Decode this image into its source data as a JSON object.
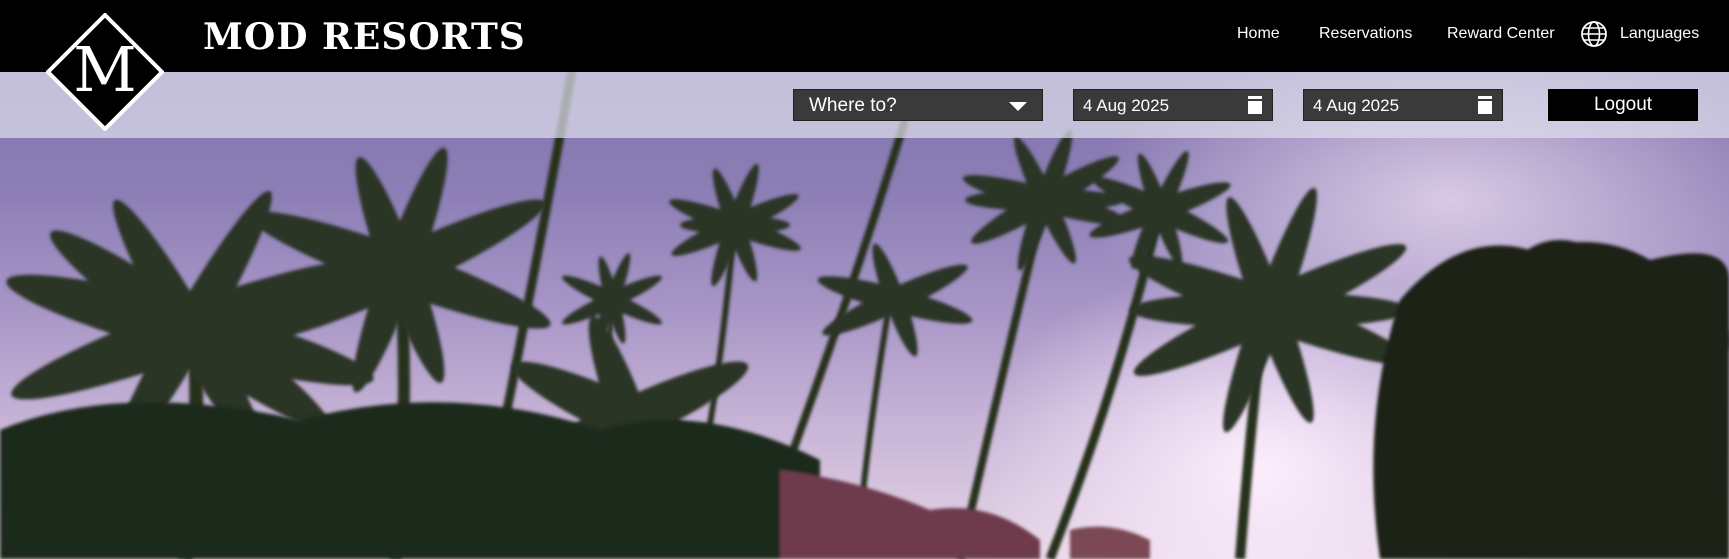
{
  "brand": {
    "name": "MOD RESORTS",
    "logo_letter": "M"
  },
  "nav": {
    "items": [
      "Home",
      "Reservations",
      "Reward Center"
    ],
    "languages_label": "Languages"
  },
  "search": {
    "destination_value": "Where to?",
    "check_in": "4 Aug 2025",
    "check_out": "4 Aug 2025",
    "logout_label": "Logout"
  },
  "icons": {
    "globe": "globe-icon",
    "dropdown": "caret-down-icon",
    "calendar": "calendar-icon"
  },
  "colors": {
    "topbar": "#000000",
    "strip": "#dedeec",
    "field_bg": "#3a3a3a",
    "sky_top": "#7a6aa6",
    "sky_glow": "#f0dcf0"
  }
}
